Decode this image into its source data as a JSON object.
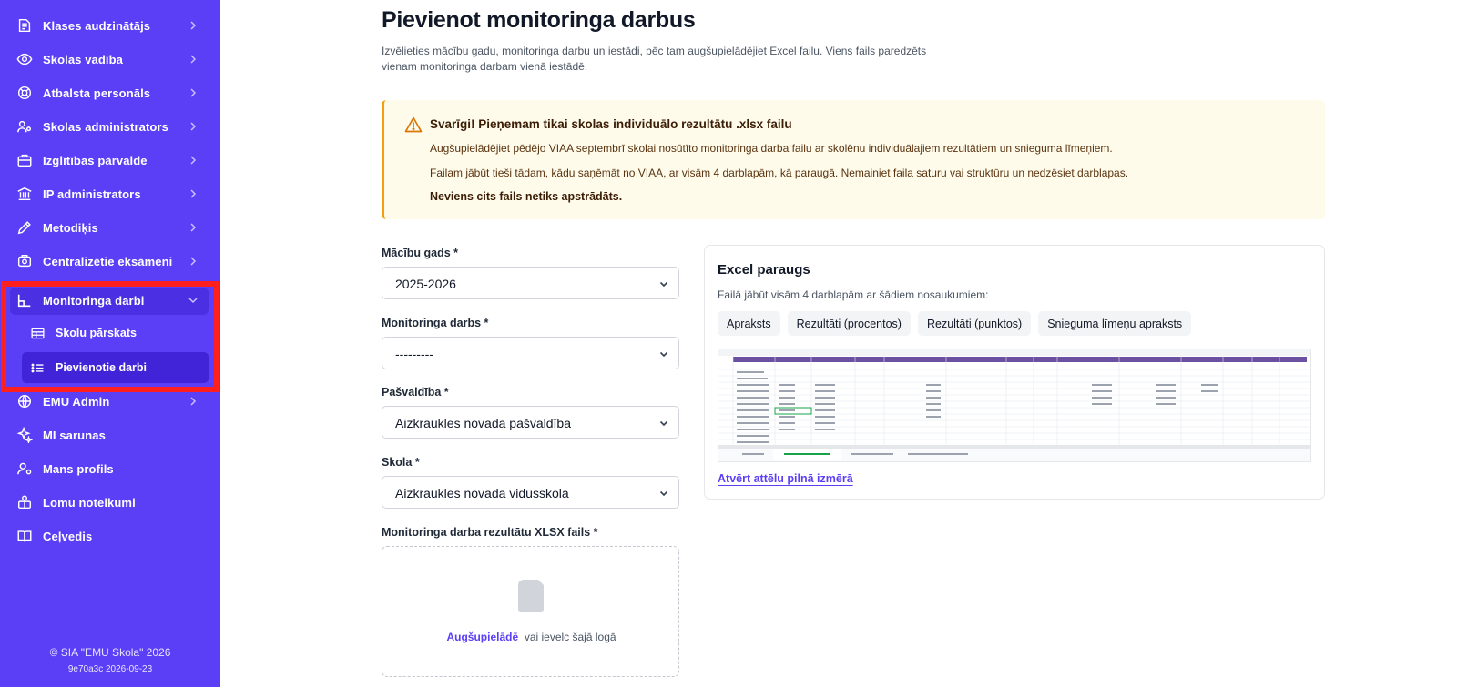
{
  "sidebar": {
    "items": [
      {
        "label": "Klases audzinātājs",
        "icon": "graduation-icon"
      },
      {
        "label": "Skolas vadība",
        "icon": "eye-icon"
      },
      {
        "label": "Atbalsta personāls",
        "icon": "support-icon"
      },
      {
        "label": "Skolas administrators",
        "icon": "users-gear-icon"
      },
      {
        "label": "Izglītības pārvalde",
        "icon": "briefcase-icon"
      },
      {
        "label": "IP administrators",
        "icon": "institution-icon"
      },
      {
        "label": "Metodiķis",
        "icon": "pen-icon"
      },
      {
        "label": "Centralizētie eksāmeni",
        "icon": "exam-icon"
      },
      {
        "label": "Monitoringa darbi",
        "icon": "monitoring-icon"
      },
      {
        "label": "EMU Admin",
        "icon": "globe-icon"
      },
      {
        "label": "MI sarunas",
        "icon": "sparkle-icon"
      },
      {
        "label": "Mans profils",
        "icon": "user-gear-icon"
      },
      {
        "label": "Lomu noteikumi",
        "icon": "role-icon"
      },
      {
        "label": "Ceļvedis",
        "icon": "book-icon"
      }
    ],
    "sub_items": [
      {
        "label": "Skolu pārskats",
        "icon": "table-icon"
      },
      {
        "label": "Pievienotie darbi",
        "icon": "list-icon"
      }
    ],
    "footer_copy": "© SIA \"EMU Skola\" 2026",
    "footer_version": "9e70a3c 2026-09-23"
  },
  "page": {
    "title": "Pievienot monitoringa darbus",
    "description": "Izvēlieties mācību gadu, monitoringa darbu un iestādi, pēc tam augšupielādējiet Excel failu. Viens fails paredzēts vienam monitoringa darbam vienā iestādē."
  },
  "alert": {
    "title": "Svarīgi! Pieņemam tikai skolas individuālo rezultātu .xlsx failu",
    "line1": "Augšupielādējiet pēdējo VIAA septembrī skolai nosūtīto monitoringa darba failu ar skolēnu individuālajiem rezultātiem un snieguma līmeņiem.",
    "line2": "Failam jābūt tieši tādam, kādu saņēmāt no VIAA, ar visām 4 darblapām, kā paraugā. Nemainiet faila saturu vai struktūru un nedzēsiet darblapas.",
    "bold": "Neviens cits fails netiks apstrādāts."
  },
  "form": {
    "year_label": "Mācību gads *",
    "year_value": "2025-2026",
    "work_label": "Monitoringa darbs *",
    "work_value": "---------",
    "municipality_label": "Pašvaldība *",
    "municipality_value": "Aizkraukles novada pašvaldība",
    "school_label": "Skola *",
    "school_value": "Aizkraukles novada vidusskola",
    "file_label": "Monitoringa darba rezultātu XLSX fails *",
    "upload_link": "Augšupielādē",
    "upload_rest": "vai ievelc šajā logā"
  },
  "example": {
    "title": "Excel paraugs",
    "description": "Failā jābūt visām 4 darblapām ar šādiem nosaukumiem:",
    "sheets": [
      "Apraksts",
      "Rezultāti (procentos)",
      "Rezultāti (punktos)",
      "Snieguma līmeņu apraksts"
    ],
    "open_link": "Atvērt attēlu pilnā izmērā"
  },
  "colors": {
    "sidebar_bg": "#5b3ff7",
    "accent": "#5b3ff7",
    "highlight": "#ff1f1f",
    "alert_bg": "#fffbeb",
    "alert_border": "#f59e0b"
  }
}
